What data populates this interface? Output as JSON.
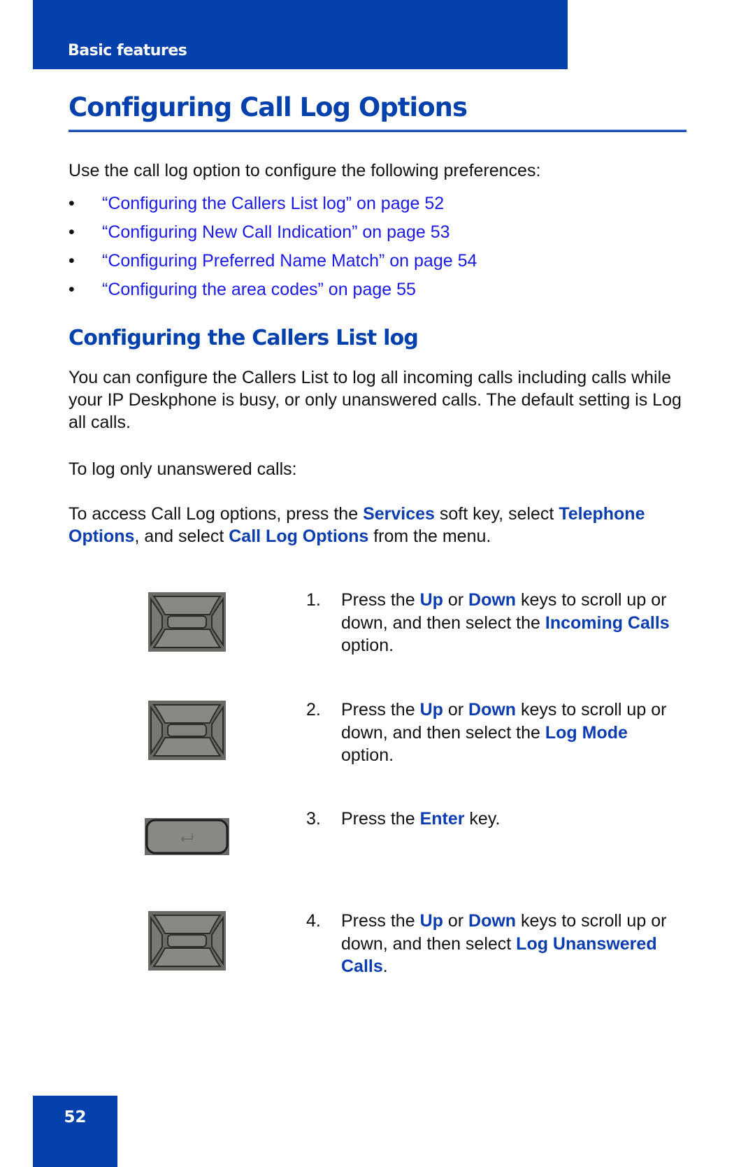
{
  "header": {
    "section": "Basic features"
  },
  "title": "Configuring Call Log Options",
  "intro": "Use the call log option to configure the following preferences:",
  "bullet_char": "•",
  "links": [
    {
      "label": "“Configuring the Callers List log” on page 52"
    },
    {
      "label": "“Configuring New Call Indication” on page 53"
    },
    {
      "label": "“Configuring Preferred Name Match” on page 54"
    },
    {
      "label": "“Configuring the area codes” on page 55"
    }
  ],
  "section": {
    "heading": "Configuring the Callers List log",
    "para1": "You can configure the Callers List to log all incoming calls including calls while your IP Deskphone is busy, or only unanswered calls. The default setting is Log all calls.",
    "para2": "To log only unanswered calls:",
    "para3": {
      "t1": "To access Call Log options, press the ",
      "k1": "Services",
      "t2": " soft key, select ",
      "k2": "Telephone Options",
      "t3": ", and select ",
      "k3": "Call Log Options",
      "t4": " from the menu."
    }
  },
  "steps": [
    {
      "num": "1.",
      "icon": "navigation-keypad",
      "t1": "Press the ",
      "k1": "Up",
      "t2": " or ",
      "k2": "Down",
      "t3": " keys to scroll up or down, and then select the ",
      "k3": "Incoming Calls",
      "t4": " option."
    },
    {
      "num": "2.",
      "icon": "navigation-keypad",
      "t1": "Press the ",
      "k1": "Up",
      "t2": " or ",
      "k2": "Down",
      "t3": " keys to scroll up or down, and then select the ",
      "k3": "Log Mode",
      "t4": " option."
    },
    {
      "num": "3.",
      "icon": "enter-key",
      "t1": "Press the ",
      "k1": "Enter",
      "t2": " key."
    },
    {
      "num": "4.",
      "icon": "navigation-keypad",
      "t1": "Press the ",
      "k1": "Up",
      "t2": " or ",
      "k2": "Down",
      "t3": " keys to scroll up or down, and then select ",
      "k3": "Log Unanswered Calls",
      "t4": "."
    }
  ],
  "footer": {
    "page_number": "52"
  },
  "colors": {
    "brand_blue": "#0441ad",
    "link_blue": "#1a1ae6",
    "ui_term_blue": "#0c3db0"
  }
}
